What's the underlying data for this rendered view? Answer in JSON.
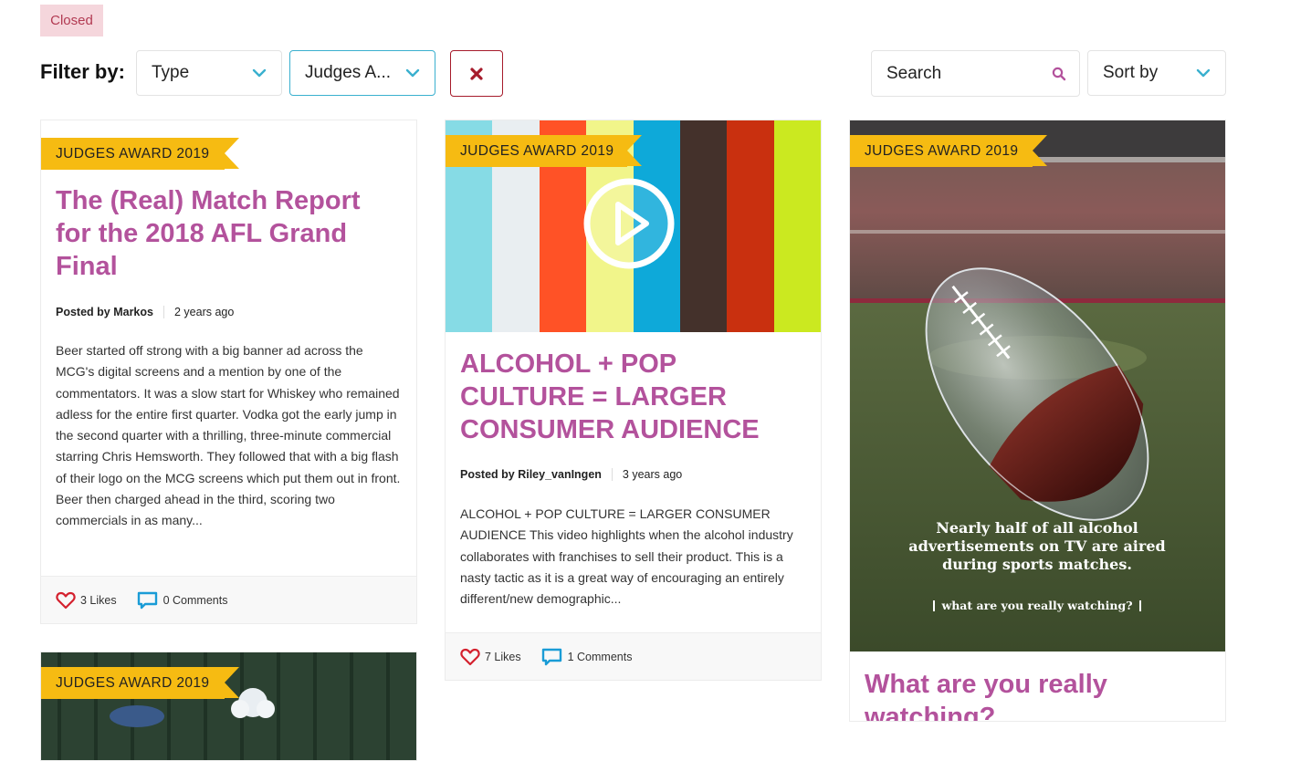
{
  "status": {
    "closed_label": "Closed"
  },
  "filters": {
    "label": "Filter by:",
    "type_value": "Type",
    "category_value": "Judges A...",
    "search_placeholder": "Search",
    "sort_value": "Sort by"
  },
  "colors": {
    "accent_title": "#b3529c",
    "ribbon": "#f6bb12",
    "clear_button": "#a61b2b",
    "active_border": "#3ab0cf",
    "stripes": [
      "#86dbe5",
      "#e9eef1",
      "#ff5226",
      "#f1f58a",
      "#0ea9d9",
      "#44312b",
      "#c9300f",
      "#cbe920"
    ]
  },
  "cards": [
    {
      "ribbon": "JUDGES AWARD 2019",
      "title": "The (Real) Match Report for the 2018 AFL Grand Final",
      "author": "Posted by Markos",
      "time": "2 years ago",
      "excerpt": "Beer started off strong with a big banner ad across the MCG's digital screens and a mention by one of the commentators. It was a slow start for Whiskey who remained adless for the entire first quarter. Vodka got the early jump in the second quarter with a thrilling, three-minute commercial starring Chris Hemsworth. They followed that with a big flash of their logo on the MCG screens which put them out in front. Beer then charged ahead in the third, scoring two commercials in as many...",
      "likes": "3 Likes",
      "comments": "0 Comments"
    },
    {
      "ribbon": "JUDGES AWARD 2019",
      "title": "ALCOHOL + POP CULTURE = LARGER CONSUMER AUDIENCE",
      "author": "Posted by Riley_vanIngen",
      "time": "3 years ago",
      "excerpt": "ALCOHOL + POP CULTURE = LARGER CONSUMER AUDIENCE This video highlights when the alcohol industry collaborates with franchises to sell their product. This is a nasty tactic as it is a great way of encouraging an entirely different/new demographic...",
      "likes": "7 Likes",
      "comments": "1 Comments"
    },
    {
      "ribbon": "JUDGES AWARD 2019",
      "image_text_1": "Nearly half of all alcohol",
      "image_text_2": "advertisements on TV are aired",
      "image_text_3": "during sports matches.",
      "image_tagline": "what are you really watching?",
      "title": "What are you really watching?"
    },
    {
      "ribbon": "JUDGES AWARD 2019"
    }
  ]
}
